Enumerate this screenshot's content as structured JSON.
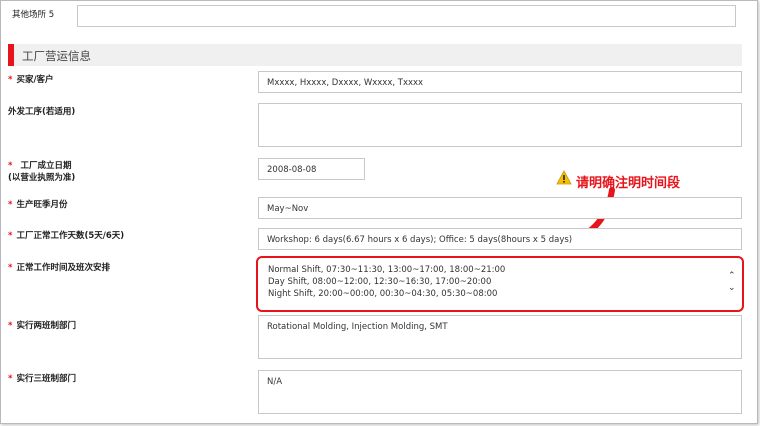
{
  "other_venue_5": {
    "label": "其他场所 5",
    "value": ""
  },
  "section": {
    "title": "工厂营运信息"
  },
  "fields": {
    "buyer": {
      "label": "买家/客户",
      "value": "Mxxxx, Hxxxx, Dxxxx, Wxxxx, Txxxx"
    },
    "outsourcing": {
      "label": "外发工序(若适用)",
      "value": ""
    },
    "founded": {
      "label_line1": "工厂成立日期",
      "label_line2": "(以营业执照为准)",
      "value": "2008-08-08"
    },
    "peak_season": {
      "label": "生产旺季月份",
      "value": "May~Nov"
    },
    "work_days": {
      "label": "工厂正常工作天数(5天/6天)",
      "value": "Workshop: 6 days(6.67 hours x 6 days); Office: 5 days(8hours x 5 days)"
    },
    "work_hours": {
      "label": "正常工作时间及班次安排",
      "lines": [
        "Normal Shift, 07:30~11:30, 13:00~17:00, 18:00~21:00",
        "Day Shift, 08:00~12:00, 12:30~16:30, 17:00~20:00",
        "Night Shift, 20:00~00:00, 00:30~04:30, 05:30~08:00"
      ]
    },
    "two_shift": {
      "label": "实行两班制部门",
      "value": "Rotational Molding, Injection Molding, SMT"
    },
    "three_shift": {
      "label": "实行三班制部门",
      "value": "N/A"
    }
  },
  "annotation": {
    "text": "请明确注明时间段",
    "icon": "warning-icon",
    "color": "#e8141b"
  },
  "required_mark": "*"
}
